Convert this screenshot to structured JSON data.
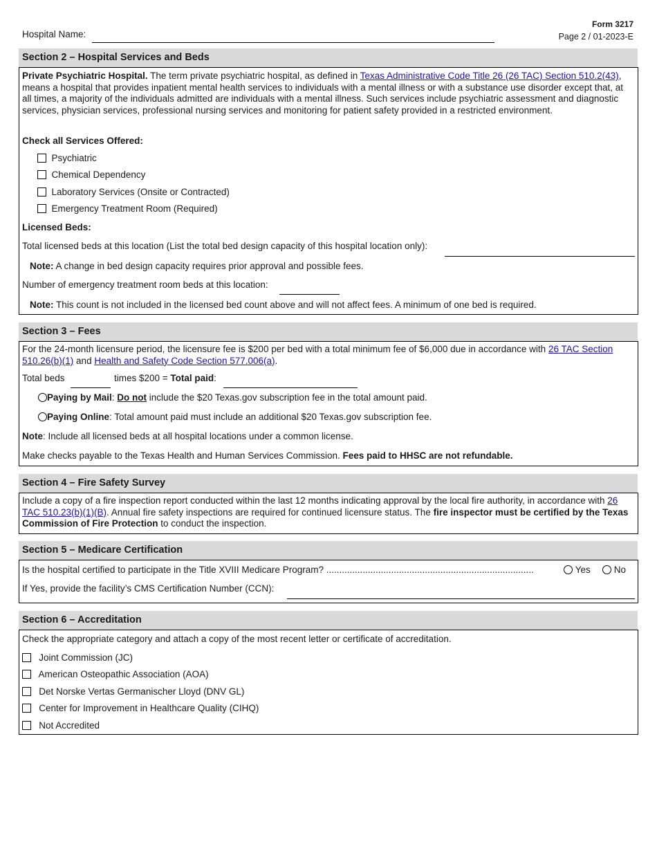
{
  "header": {
    "hospital_name_label": "Hospital Name:",
    "hospital_name_value": "",
    "form_number": "Form 3217",
    "page_info": "Page 2  / 01-2023-E"
  },
  "section2": {
    "title": "Section 2 – Hospital Services and Beds",
    "intro_bold": "Private Psychiatric Hospital.",
    "intro_pre": " The term private psychiatric hospital, as defined in ",
    "intro_link": "Texas Administrative Code Title 26 (26 TAC) Section 510.2(43)",
    "intro_post": ", means a hospital that provides inpatient mental health services to individuals with a mental illness or with a substance use disorder except that, at all times, a majority of the individuals admitted are individuals with a mental illness. Such services include psychiatric assessment and diagnostic services, physician services, professional nursing services and monitoring for patient safety provided in a restricted environment.",
    "services_heading": "Check all Services Offered:",
    "services": [
      {
        "label": "Psychiatric",
        "checked": false
      },
      {
        "label": "Chemical Dependency",
        "checked": false
      },
      {
        "label": "Laboratory Services (Onsite or Contracted)",
        "checked": false
      },
      {
        "label": "Emergency Treatment Room (Required)",
        "checked": false
      }
    ],
    "beds_heading": "Licensed Beds:",
    "total_beds_label": "Total licensed beds at this location (List the total bed design capacity of this hospital location only):",
    "total_beds_value": "",
    "note1_bold": "Note:",
    "note1_text": " A change in bed design capacity requires prior approval and possible fees.",
    "er_beds_label": "Number of emergency treatment room beds at this location:",
    "er_beds_value": "",
    "note2_bold": "Note:",
    "note2_text": " This count is not included in the licensed bed count above and will not affect fees. A minimum of one bed is required."
  },
  "section3": {
    "title": "Section 3 – Fees",
    "intro_pre": "For the 24-month licensure period, the licensure fee is $200 per bed with a total minimum fee of $6,000 due in accordance with ",
    "link1": "26 TAC Section 510.26(b)(1)",
    "intro_mid": " and ",
    "link2": "Health and Safety Code Section 577.006(a)",
    "intro_post": ".",
    "total_beds_label": "Total beds",
    "total_beds_value": "",
    "times_label": "times $200 = ",
    "total_paid_label": "Total paid",
    "total_paid_colon": ":",
    "total_paid_value": "",
    "mail_bold": "Paying by Mail",
    "mail_colon": ": ",
    "mail_underline": "Do not",
    "mail_text": " include the $20 Texas.gov subscription fee in the total amount paid.",
    "online_bold": "Paying Online",
    "online_text": ": Total amount paid must include an additional $20 Texas.gov subscription fee.",
    "note_bold": "Note",
    "note_text": ": Include all licensed beds at all hospital locations under a common license.",
    "checks_text": "Make checks payable to the Texas Health and Human Services Commission. ",
    "checks_bold": "Fees paid to HHSC are not refundable."
  },
  "section4": {
    "title": "Section 4 – Fire Safety Survey",
    "text_pre": "Include a copy of a fire inspection report conducted within the last 12 months indicating approval by the local fire authority, in accordance with ",
    "link": "26 TAC 510.23(b)(1)(B)",
    "text_mid": ". Annual fire safety inspections are required for continued licensure status. The ",
    "text_bold": "fire inspector must be certified by the Texas Commission of Fire Protection",
    "text_post": " to conduct the inspection."
  },
  "section5": {
    "title": "Section 5 – Medicare Certification",
    "question": "Is the hospital certified to participate in the Title XVIII Medicare Program? ................................................................................",
    "yes_label": "Yes",
    "no_label": "No",
    "ccn_label": "If Yes, provide the facility’s CMS Certification Number (CCN):",
    "ccn_value": ""
  },
  "section6": {
    "title": "Section 6 – Accreditation",
    "instruction": "Check the appropriate category and attach a copy of the most recent letter or certificate of accreditation.",
    "options": [
      {
        "label": "Joint Commission (JC)",
        "checked": false
      },
      {
        "label": "American Osteopathic Association (AOA)",
        "checked": false
      },
      {
        "label": "Det Norske Vertas Germanischer Lloyd (DNV GL)",
        "checked": false
      },
      {
        "label": "Center for Improvement in Healthcare Quality (CIHQ)",
        "checked": false
      },
      {
        "label": "Not Accredited",
        "checked": false
      }
    ]
  }
}
